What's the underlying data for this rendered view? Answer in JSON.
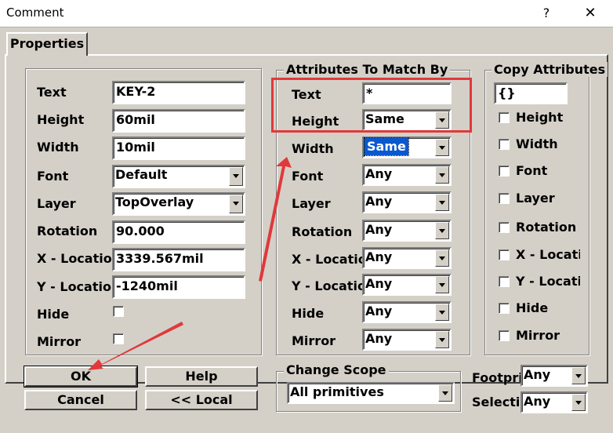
{
  "window": {
    "title": "Comment",
    "help_glyph": "?",
    "close_glyph": "✕"
  },
  "tab": {
    "label": "Properties"
  },
  "properties": {
    "text_label": "Text",
    "text_value": "KEY-2",
    "height_label": "Height",
    "height_value": "60mil",
    "width_label": "Width",
    "width_value": "10mil",
    "font_label": "Font",
    "font_value": "Default",
    "layer_label": "Layer",
    "layer_value": "TopOverlay",
    "rotation_label": "Rotation",
    "rotation_value": "90.000",
    "xloc_label": "X - Location",
    "xloc_value": "3339.567mil",
    "yloc_label": "Y - Location",
    "yloc_value": "-1240mil",
    "hide_label": "Hide",
    "mirror_label": "Mirror"
  },
  "match": {
    "title": "Attributes To Match By",
    "rows": [
      {
        "label": "Text",
        "value": "*",
        "kind": "text"
      },
      {
        "label": "Height",
        "value": "Same",
        "kind": "combo"
      },
      {
        "label": "Width",
        "value": "Same",
        "kind": "combo",
        "selected": true
      },
      {
        "label": "Font",
        "value": "Any",
        "kind": "combo"
      },
      {
        "label": "Layer",
        "value": "Any",
        "kind": "combo"
      },
      {
        "label": "Rotation",
        "value": "Any",
        "kind": "combo"
      },
      {
        "label": "X - Location",
        "value": "Any",
        "kind": "combo"
      },
      {
        "label": "Y - Location",
        "value": "Any",
        "kind": "combo"
      },
      {
        "label": "Hide",
        "value": "Any",
        "kind": "combo"
      },
      {
        "label": "Mirror",
        "value": "Any",
        "kind": "combo"
      }
    ]
  },
  "copy": {
    "title": "Copy Attributes",
    "field_value": "{}",
    "items": [
      "Height",
      "Width",
      "Font",
      "Layer",
      "Rotation",
      "X - Locatio",
      "Y - Locatio",
      "Hide",
      "Mirror"
    ]
  },
  "buttons": {
    "ok": "OK",
    "help": "Help",
    "cancel": "Cancel",
    "local": "<< Local"
  },
  "scope": {
    "title": "Change Scope",
    "value": "All primitives"
  },
  "footprint": {
    "label": "Footprint",
    "value": "Any"
  },
  "selection": {
    "label": "Selection",
    "value": "Any"
  },
  "colors": {
    "highlight_box": "#e0393b",
    "selection_bg": "#0a58d0",
    "dialog_bg": "#d4d0c8"
  }
}
